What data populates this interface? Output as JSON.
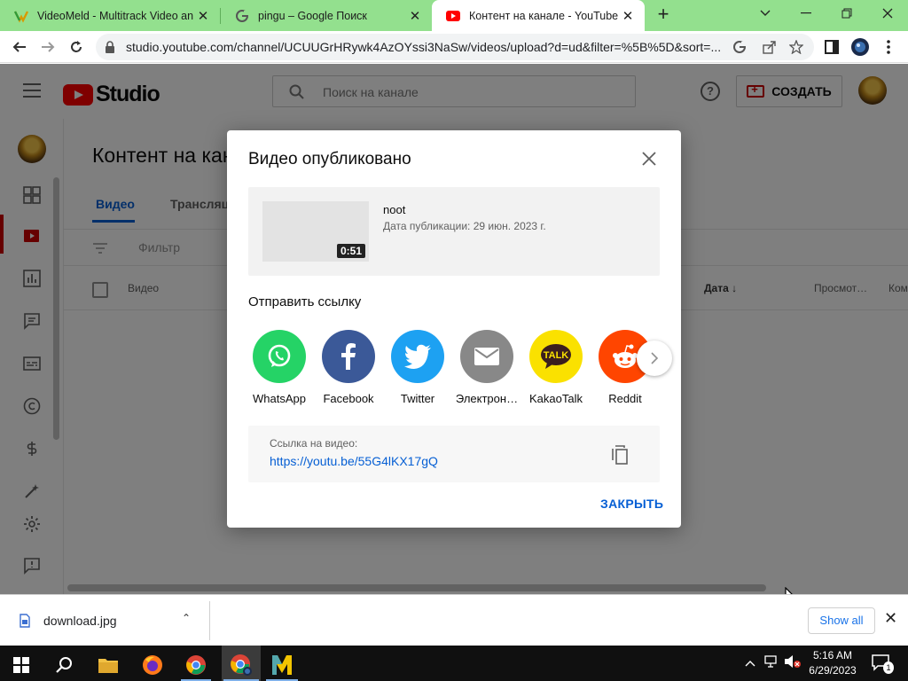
{
  "browser": {
    "tabs": [
      {
        "title": "VideoMeld - Multitrack Video an",
        "close": "✕"
      },
      {
        "title": "pingu – Google Поиск",
        "close": "✕"
      },
      {
        "title": "Контент на канале - YouTube St",
        "close": "✕"
      }
    ],
    "new_tab": "+",
    "url": "studio.youtube.com/channel/UCUUGrHRywk4AzOYssi3NaSw/videos/upload?d=ud&filter=%5B%5D&sort=..."
  },
  "studio": {
    "logo_text": "Studio",
    "search_placeholder": "Поиск на канале",
    "help": "?",
    "create_label": "СОЗДАТЬ",
    "content_title": "Контент на канале",
    "tabs": [
      "Видео",
      "Трансляции"
    ],
    "filter_placeholder": "Фильтр",
    "columns": {
      "video": "Видео",
      "date": "Дата ↓",
      "views": "Просмот…",
      "comments": "Ком"
    }
  },
  "dialog": {
    "title": "Видео опубликовано",
    "video": {
      "title": "noot",
      "date": "Дата публикации: 29 июн. 2023 г.",
      "duration": "0:51"
    },
    "share_label": "Отправить ссылку",
    "share_targets": [
      {
        "name": "WhatsApp",
        "color": "#25d366",
        "icon": "whatsapp-icon"
      },
      {
        "name": "Facebook",
        "color": "#3b5998",
        "icon": "facebook-icon"
      },
      {
        "name": "Twitter",
        "color": "#1da1f2",
        "icon": "twitter-icon"
      },
      {
        "name": "Электрон…",
        "color": "#888888",
        "icon": "email-icon"
      },
      {
        "name": "KakaoTalk",
        "color": "#fae100",
        "icon": "kakaotalk-icon"
      },
      {
        "name": "Reddit",
        "color": "#ff4500",
        "icon": "reddit-icon"
      }
    ],
    "link_label": "Ссылка на видео:",
    "link_url": "https://youtu.be/55G4lKX17gQ",
    "close_action": "ЗАКРЫТЬ"
  },
  "downloads": {
    "file_name": "download.jpg",
    "chevron": "⌃",
    "show_all": "Show all",
    "close": "✕"
  },
  "taskbar": {
    "time": "5:16 AM",
    "date": "6/29/2023",
    "notification_count": "1"
  },
  "colors": {
    "tab_strip": "#93e08e",
    "youtube_red": "#ff0000",
    "link_blue": "#065fd4"
  }
}
